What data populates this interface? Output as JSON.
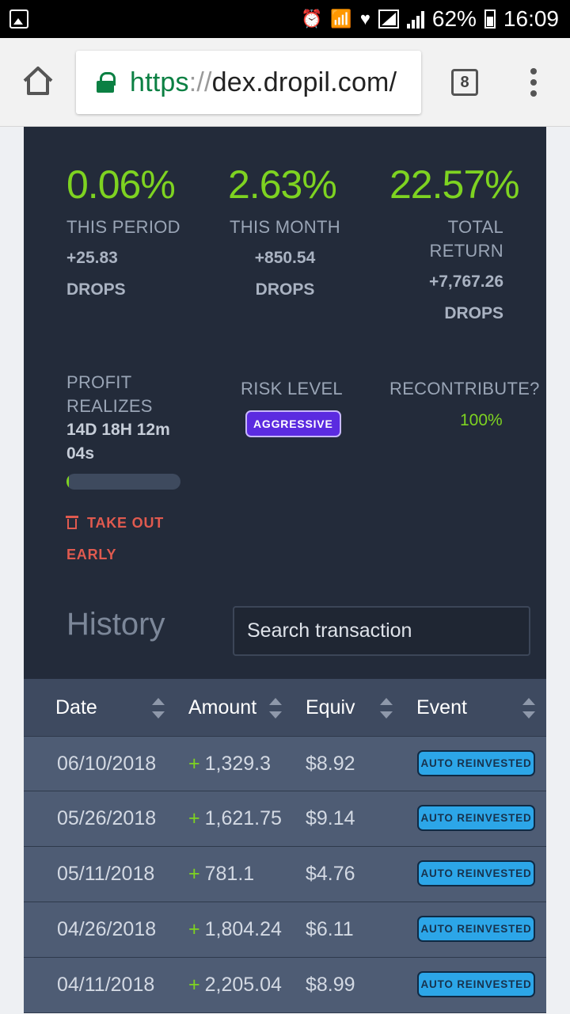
{
  "status_bar": {
    "battery": "62%",
    "time": "16:09"
  },
  "browser": {
    "url_scheme": "https",
    "url_sep": "://",
    "url_host": "dex.dropil.com/",
    "tab_count": "8"
  },
  "stats": [
    {
      "percent": "0.06%",
      "label": "THIS PERIOD",
      "amount": "+25.83",
      "unit": "DROPS"
    },
    {
      "percent": "2.63%",
      "label": "THIS MONTH",
      "amount": "+850.54",
      "unit": "DROPS"
    },
    {
      "percent": "22.57%",
      "label_line1": "TOTAL",
      "label_line2": "RETURN",
      "amount": "+7,767.26",
      "unit": "DROPS"
    }
  ],
  "profit": {
    "label_line1": "PROFIT",
    "label_line2": "REALIZES",
    "countdown_line1": "14D 18H 12m",
    "countdown_line2": "04s",
    "progress": 0.02,
    "take_out_line1": "TAKE OUT",
    "take_out_line2": "EARLY"
  },
  "risk": {
    "label": "RISK LEVEL",
    "value": "AGGRESSIVE"
  },
  "recontribute": {
    "label": "RECONTRIBUTE?",
    "value": "100%"
  },
  "history": {
    "title": "History",
    "search_placeholder": "Search transaction",
    "columns": [
      "Date",
      "Amount",
      "Equiv",
      "Event"
    ],
    "rows": [
      {
        "date": "06/10/2018",
        "amount": "1,329.3",
        "equiv": "$8.92",
        "event": "AUTO REINVESTED"
      },
      {
        "date": "05/26/2018",
        "amount": "1,621.75",
        "equiv": "$9.14",
        "event": "AUTO REINVESTED"
      },
      {
        "date": "05/11/2018",
        "amount": "781.1",
        "equiv": "$4.76",
        "event": "AUTO REINVESTED"
      },
      {
        "date": "04/26/2018",
        "amount": "1,804.24",
        "equiv": "$6.11",
        "event": "AUTO REINVESTED"
      },
      {
        "date": "04/11/2018",
        "amount": "2,205.04",
        "equiv": "$8.99",
        "event": "AUTO REINVESTED"
      }
    ]
  },
  "colors": {
    "accent_green": "#7ed321",
    "card_bg": "#232b3a",
    "risk_badge": "#5b2be0",
    "event_badge": "#2ca6e8",
    "danger": "#e05a4f"
  }
}
